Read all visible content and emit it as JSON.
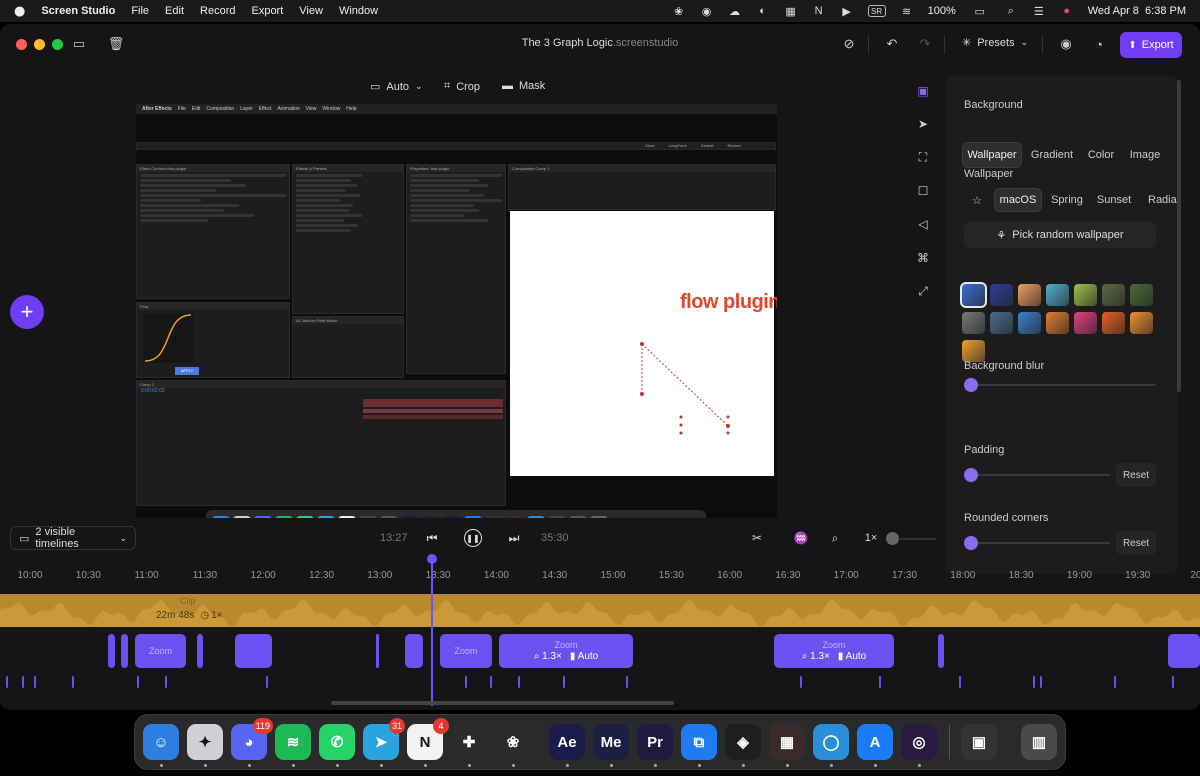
{
  "menubar": {
    "app_name": "Screen Studio",
    "items": [
      "File",
      "Edit",
      "Record",
      "Export",
      "View",
      "Window"
    ],
    "battery": "100%",
    "datetime": "Wed Apr 8  6:38 PM",
    "sr_label": "SR"
  },
  "window": {
    "title": "The 3 Graph Logic",
    "title_ext": ".screenstudio",
    "presets_label": "Presets",
    "export_label": "Export"
  },
  "canvas_toolbar": {
    "auto_label": "Auto",
    "crop_label": "Crop",
    "mask_label": "Mask"
  },
  "recording": {
    "app": "After Effects",
    "menus": [
      "File",
      "Edit",
      "Composition",
      "Layer",
      "Effect",
      "Animation",
      "View",
      "Window",
      "Help"
    ],
    "comp_text": "flow plugin",
    "tabs": [
      "Short",
      "LongForm",
      "Default",
      "Review"
    ],
    "panels": {
      "effect_controls": "Effect Controls flow plugin",
      "effects_presets": "Effects & Presets",
      "properties": "Properties: flow plugin",
      "composition": "Composition Comp 1",
      "flow": "Flow",
      "anchor": "AC Anchor Point Mover",
      "timeline": "Comp 1",
      "apply": "APPLY",
      "timecode": "0:00:02:02"
    }
  },
  "right_panel": {
    "background_label": "Background",
    "bg_tabs": [
      "Wallpaper",
      "Gradient",
      "Color",
      "Image"
    ],
    "bg_active": "Wallpaper",
    "wallpaper_label": "Wallpaper",
    "wallpaper_chips": [
      "macOS",
      "Spring",
      "Sunset",
      "Radia"
    ],
    "wallpaper_active": "macOS",
    "random_label": "Pick random wallpaper",
    "blur_label": "Background blur",
    "blur_value": 0,
    "padding_label": "Padding",
    "padding_value": 0,
    "padding_reset": "Reset",
    "corners_label": "Rounded corners",
    "corners_value": 0,
    "corners_reset": "Reset",
    "wallpaper_colors": [
      "#3b6fd6",
      "#2a3f9a",
      "#f0a060",
      "#4fb0d0",
      "#9fc050",
      "#5a6a40",
      "#4a6a3a",
      "#777777",
      "#4a6a90",
      "#3a80d0",
      "#e08030",
      "#e04080",
      "#e86020",
      "#f09030",
      "#f0a030"
    ]
  },
  "timeline": {
    "visible_label": "2 visible timelines",
    "time_left": "13:27",
    "time_right": "35:30",
    "speed_label": "1×",
    "ruler": [
      "10:00",
      "10:30",
      "11:00",
      "11:30",
      "12:00",
      "12:30",
      "13:00",
      "13:30",
      "14:00",
      "14:30",
      "15:00",
      "15:30",
      "16:00",
      "16:30",
      "17:00",
      "17:30",
      "18:00",
      "18:30",
      "19:00",
      "19:30",
      "20"
    ],
    "clip_label": "Clip",
    "clip_duration": "22m 48s",
    "clip_speed": "1×",
    "zoom_label": "Zoom",
    "zoom_level": "1.3×",
    "zoom_mode": "Auto"
  },
  "dock": {
    "badges": {
      "discord": "119",
      "telegram": "31",
      "notion": "4"
    },
    "apps": [
      {
        "name": "finder",
        "glyph": "☺",
        "color": "#2f7fe0"
      },
      {
        "name": "screen-studio",
        "glyph": "✦",
        "color": "#cfcfd4"
      },
      {
        "name": "discord",
        "glyph": "◕",
        "color": "#5865f2"
      },
      {
        "name": "spotify",
        "glyph": "≋",
        "color": "#1db954"
      },
      {
        "name": "whatsapp",
        "glyph": "✆",
        "color": "#25d366"
      },
      {
        "name": "telegram",
        "glyph": "➤",
        "color": "#2aa3e0"
      },
      {
        "name": "notion",
        "glyph": "N",
        "color": "#f2f2f2"
      },
      {
        "name": "slack",
        "glyph": "✚",
        "color": "#2b2b2e"
      },
      {
        "name": "chatgpt",
        "glyph": "❀",
        "color": "#2b2b2e"
      },
      {
        "name": "after-effects",
        "glyph": "Ae",
        "color": "#1a1b4a"
      },
      {
        "name": "media-encoder",
        "glyph": "Me",
        "color": "#1b1f44"
      },
      {
        "name": "premiere",
        "glyph": "Pr",
        "color": "#1e1a40"
      },
      {
        "name": "framer",
        "glyph": "⧉",
        "color": "#1e7cf0"
      },
      {
        "name": "figma",
        "glyph": "◈",
        "color": "#1e1e1e"
      },
      {
        "name": "grid-app",
        "glyph": "▦",
        "color": "#3a2a2a"
      },
      {
        "name": "quicktime",
        "glyph": "◯",
        "color": "#2a8fd8"
      },
      {
        "name": "app-store",
        "glyph": "A",
        "color": "#1c7cf5"
      },
      {
        "name": "orb-app",
        "glyph": "◎",
        "color": "#2a1a40"
      },
      {
        "name": "photo",
        "glyph": "▣",
        "color": "#333333"
      },
      {
        "name": "trash",
        "glyph": "▥",
        "color": "#4a4a4d"
      }
    ]
  }
}
